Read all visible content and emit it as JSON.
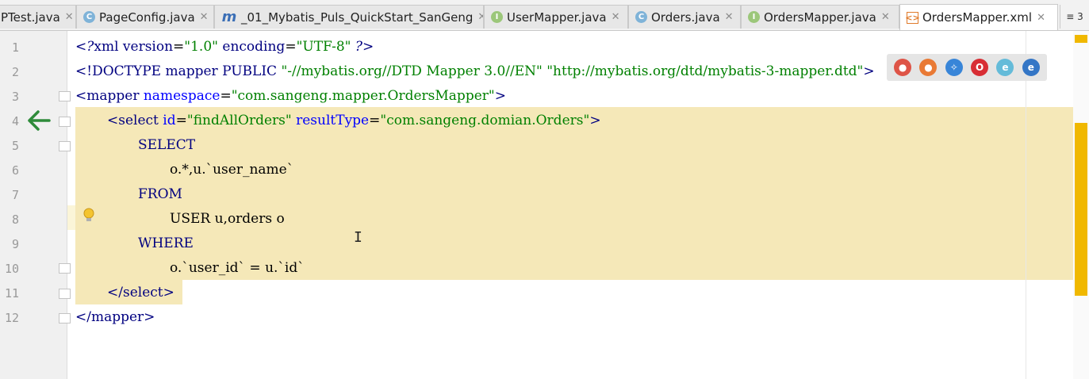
{
  "tabs": [
    {
      "icon": "class-icon",
      "label": "PTest.java",
      "active": false
    },
    {
      "icon": "class-icon",
      "label": "PageConfig.java",
      "active": false
    },
    {
      "icon": "module-icon",
      "label": "_01_Mybatis_Puls_QuickStart_SanGeng",
      "active": false
    },
    {
      "icon": "interface-icon",
      "label": "UserMapper.java",
      "active": false
    },
    {
      "icon": "class-icon",
      "label": "Orders.java",
      "active": false
    },
    {
      "icon": "interface-icon",
      "label": "OrdersMapper.java",
      "active": false
    },
    {
      "icon": "xml-icon",
      "label": "OrdersMapper.xml",
      "active": true
    }
  ],
  "tab_overflow": "≡ 3",
  "line_numbers": [
    "1",
    "2",
    "3",
    "4",
    "5",
    "6",
    "7",
    "8",
    "9",
    "10",
    "11",
    "12"
  ],
  "code": {
    "l1": {
      "a": "<?",
      "b": "xml version",
      "c": "=",
      "d": "\"1.0\"",
      "e": " encoding",
      "f": "=",
      "g": "\"UTF-8\"",
      "h": " ?>"
    },
    "l2": {
      "a": "<!DOCTYPE ",
      "b": "mapper",
      "c": " PUBLIC ",
      "d": "\"-//mybatis.org//DTD Mapper 3.0//EN\"",
      "e": " ",
      "f": "\"http://mybatis.org/dtd/mybatis-3-mapper.dtd\"",
      "g": ">"
    },
    "l3": {
      "a": "<mapper ",
      "b": "namespace",
      "c": "=",
      "d": "\"com.sangeng.mapper.OrdersMapper\"",
      "e": ">"
    },
    "l4": {
      "a": "<select ",
      "b": "id",
      "c": "=",
      "d": "\"findAllOrders\"",
      "e": " resultType",
      "f": "=",
      "g": "\"com.sangeng.domian.Orders\"",
      "h": ">"
    },
    "l5": "SELECT",
    "l6": "o.*,u.`user_name`",
    "l7": "FROM",
    "l8": "USER u,orders o",
    "l9": "WHERE",
    "l10": "o.`user_id` = u.`id`",
    "l11": "</select>",
    "l12": "</mapper>"
  },
  "browser_icons": [
    "chrome-icon",
    "firefox-icon",
    "safari-icon",
    "opera-icon",
    "ie-icon",
    "edge-icon"
  ],
  "colors": {
    "highlight": "#f5e8b8",
    "scroll_marker": "#f0b800",
    "tag": "#000080",
    "attribute": "#0000ff",
    "value": "#008000",
    "arrow": "#2e8b3a"
  }
}
